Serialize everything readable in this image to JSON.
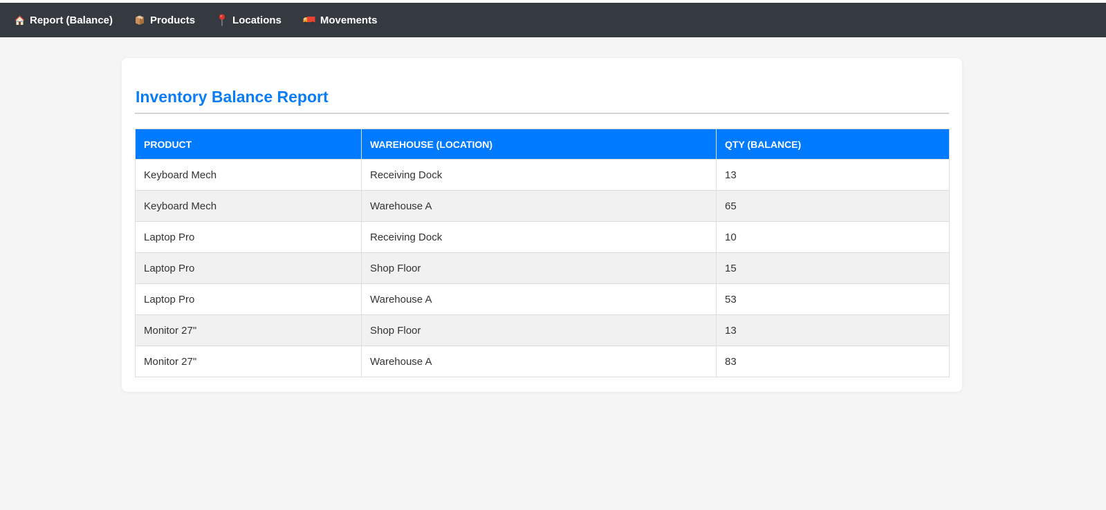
{
  "nav": {
    "items": [
      {
        "label": "Report (Balance)",
        "icon": "house-icon"
      },
      {
        "label": "Products",
        "icon": "package-icon"
      },
      {
        "label": "Locations",
        "icon": "pushpin-icon"
      },
      {
        "label": "Movements",
        "icon": "truck-icon"
      }
    ]
  },
  "report": {
    "title": "Inventory Balance Report",
    "columns": [
      "PRODUCT",
      "WAREHOUSE (LOCATION)",
      "QTY (BALANCE)"
    ],
    "rows": [
      [
        "Keyboard Mech",
        "Receiving Dock",
        "13"
      ],
      [
        "Keyboard Mech",
        "Warehouse A",
        "65"
      ],
      [
        "Laptop Pro",
        "Receiving Dock",
        "10"
      ],
      [
        "Laptop Pro",
        "Shop Floor",
        "15"
      ],
      [
        "Laptop Pro",
        "Warehouse A",
        "53"
      ],
      [
        "Monitor 27\"",
        "Shop Floor",
        "13"
      ],
      [
        "Monitor 27\"",
        "Warehouse A",
        "83"
      ]
    ]
  },
  "colors": {
    "navbar": "#343a40",
    "accent": "#007bff",
    "title": "#0a7cf5",
    "page_background": "#f4f5f4",
    "row_stripe": "#f1f1f1"
  }
}
